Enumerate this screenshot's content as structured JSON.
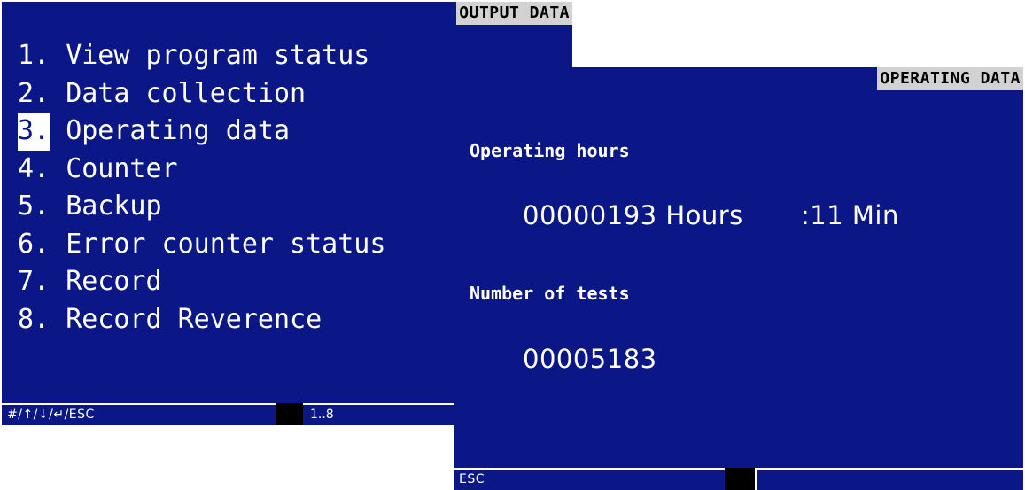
{
  "output_screen": {
    "title": "OUTPUT DATA",
    "menu": [
      {
        "num": "1.",
        "label": "View program status"
      },
      {
        "num": "2.",
        "label": "Data collection"
      },
      {
        "num": "3.",
        "label": "Operating data"
      },
      {
        "num": "4.",
        "label": "Counter"
      },
      {
        "num": "5.",
        "label": "Backup"
      },
      {
        "num": "6.",
        "label": "Error counter status"
      },
      {
        "num": "7.",
        "label": "Record"
      },
      {
        "num": "8.",
        "label": "Record Reverence"
      }
    ],
    "selected_index": 3,
    "status": {
      "keys": "#/↑/↓/↵/ESC",
      "range": "1..8"
    }
  },
  "operating_screen": {
    "title": "OPERATING DATA",
    "hours_label": "Operating hours",
    "hours_value": "00000193 Hours",
    "minutes_value": ":11 Min",
    "tests_label": "Number of tests",
    "tests_value": "00005183",
    "status": {
      "keys": "ESC"
    }
  },
  "colors": {
    "screen_bg": "#0b1786",
    "title_bg": "#d2d2d2"
  }
}
